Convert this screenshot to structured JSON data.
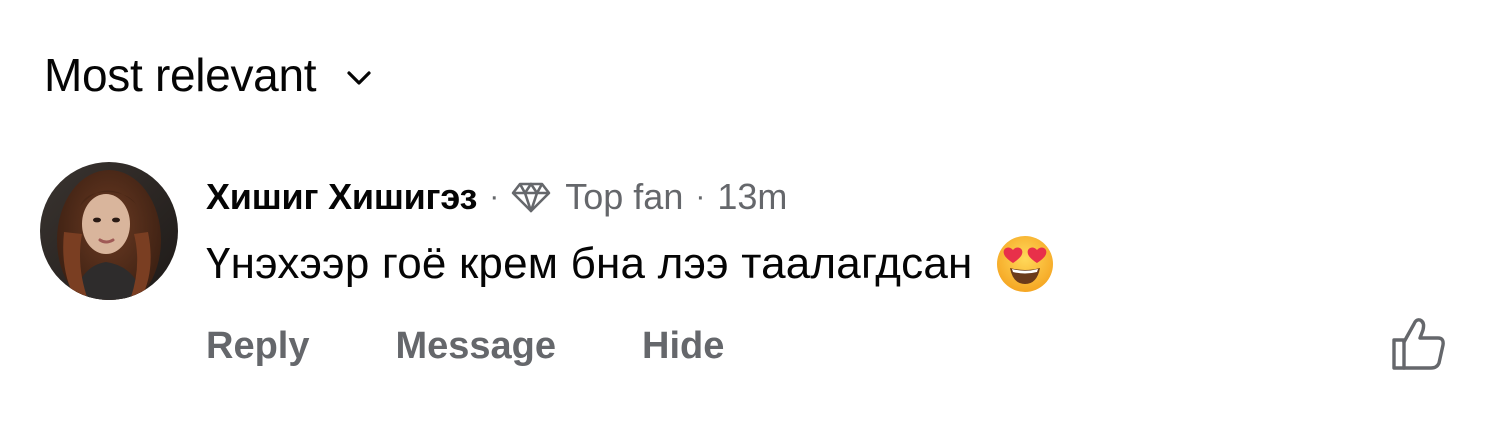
{
  "sort": {
    "label": "Most relevant",
    "icon": "chevron-down-icon"
  },
  "comment": {
    "author": "Хишиг Хишигэз",
    "separator": "·",
    "badge_icon": "diamond-icon",
    "badge_label": "Top fan",
    "time": "13m",
    "text": "Үнэхээр гоё крем бна лээ таалагдсан",
    "emoji": "smiling-face-with-heart-eyes",
    "actions": {
      "reply": "Reply",
      "message": "Message",
      "hide": "Hide"
    },
    "like_icon": "thumbs-up-icon"
  },
  "colors": {
    "text_primary": "#050505",
    "text_secondary": "#65676b",
    "background": "#ffffff"
  }
}
